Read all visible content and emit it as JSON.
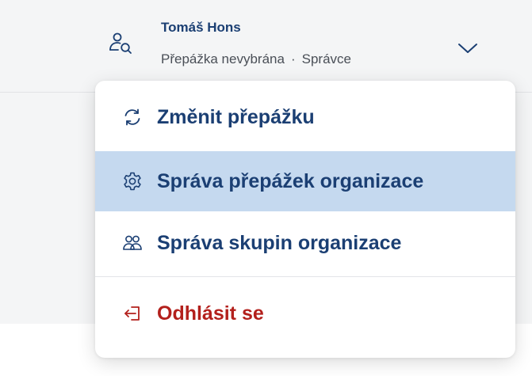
{
  "header": {
    "user_name": "Tomáš Hons",
    "counter_status": "Přepážka nevybrána",
    "separator": "·",
    "role": "Správce"
  },
  "menu": {
    "change_counter": "Změnit přepážku",
    "manage_counters": "Správa přepážek organizace",
    "manage_groups": "Správa skupin organizace",
    "logout": "Odhlásit se"
  },
  "colors": {
    "primary_text": "#1b3f73",
    "danger_text": "#b3201c",
    "highlight_bg": "#c5d9ef",
    "topbar_bg": "#f4f5f6"
  },
  "icons": {
    "user": "user-search-icon",
    "chevron": "chevron-down-icon",
    "change": "refresh-icon",
    "counters": "gear-icon",
    "groups": "users-icon",
    "logout": "logout-icon"
  },
  "state": {
    "highlighted_item": "manage_counters"
  }
}
